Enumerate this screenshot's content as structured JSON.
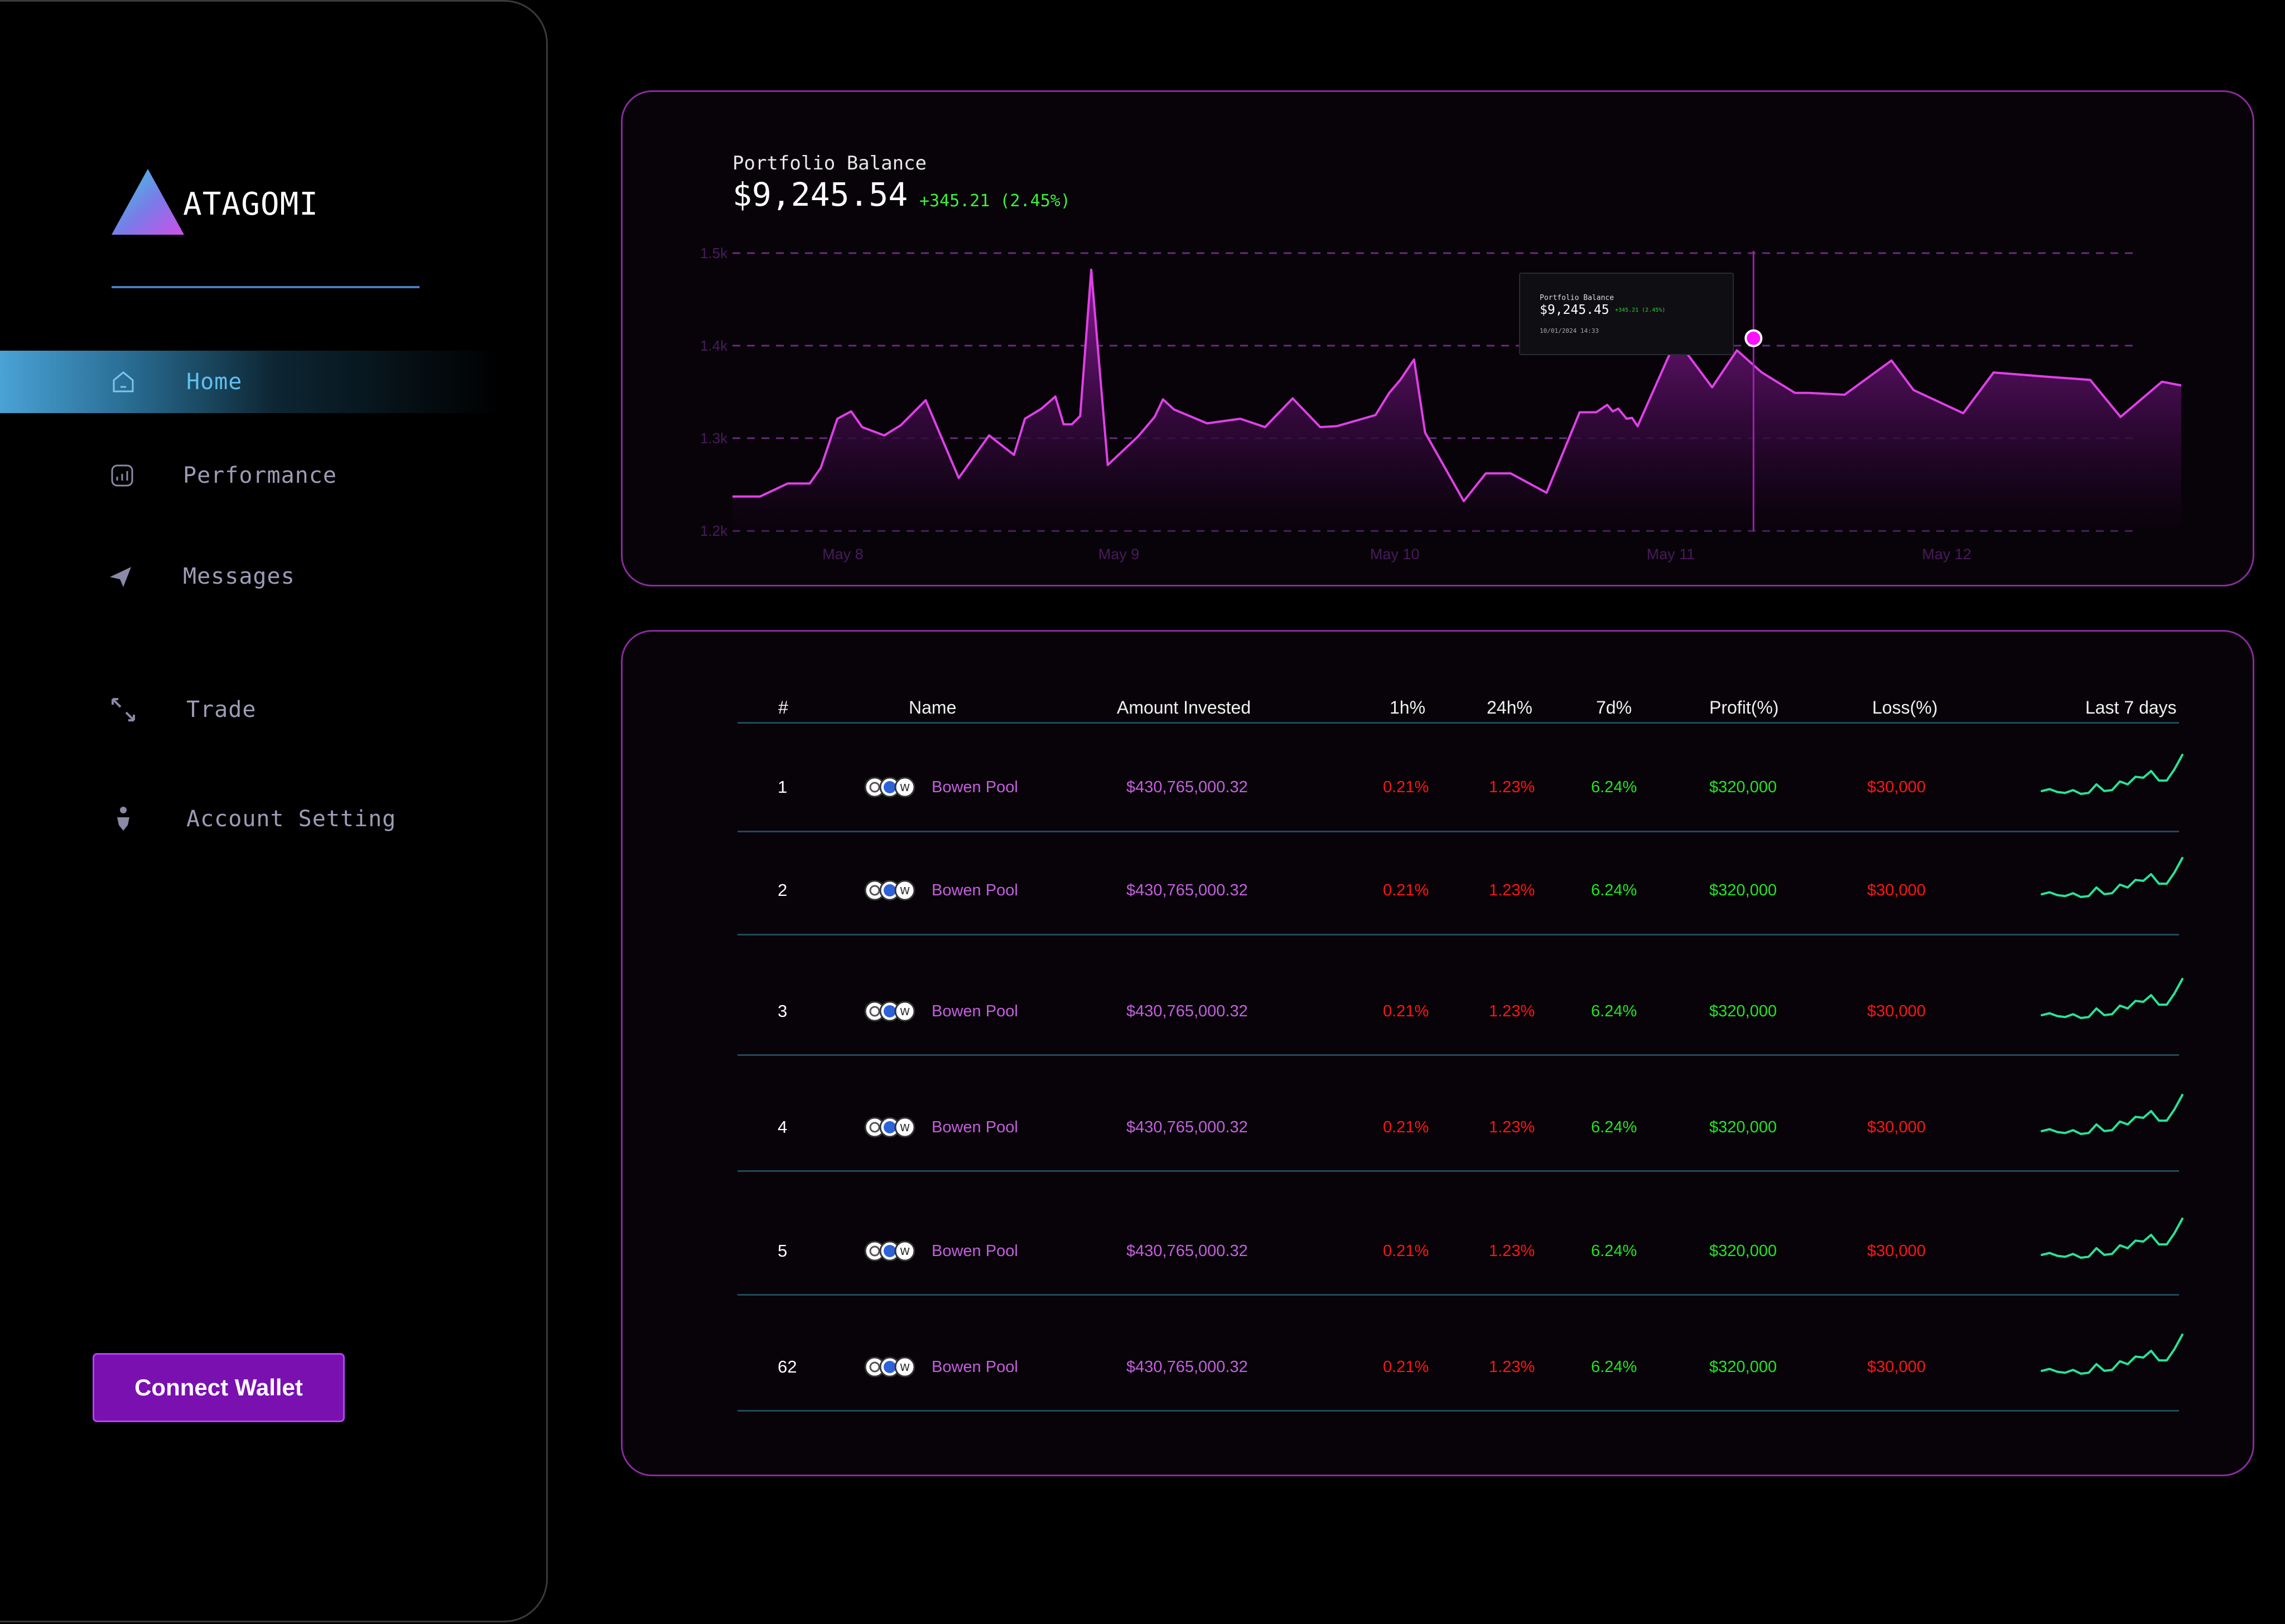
{
  "app": {
    "brand": "ATAGOMI"
  },
  "sidebar": {
    "items": [
      {
        "label": "Home",
        "icon": "home-icon",
        "active": true
      },
      {
        "label": "Performance",
        "icon": "chart-icon"
      },
      {
        "label": "Messages",
        "icon": "send-icon"
      },
      {
        "label": "Trade",
        "icon": "arrows-icon"
      },
      {
        "label": "Account Setting",
        "icon": "user-icon"
      }
    ],
    "connect_wallet": "Connect Wallet"
  },
  "portfolio": {
    "title": "Portfolio Balance",
    "value": "$9,245.54",
    "change": "+345.21 (2.45%)",
    "tooltip": {
      "title": "Portfolio Balance",
      "value": "$9,245.45",
      "change": "+345.21 (2.45%)",
      "date": "10/01/2024 14:33"
    }
  },
  "chart_data": {
    "type": "area",
    "yticks": [
      "1.5k",
      "1.4k",
      "1.3k",
      "1.2k"
    ],
    "xticks": [
      "May 8",
      "May 9",
      "May 10",
      "May 11",
      "May 12"
    ],
    "ylim": [
      1.2,
      1.5
    ],
    "x_domain": [
      7.6,
      12.85
    ],
    "series": [
      {
        "x": [
          7.6,
          7.7,
          7.8,
          7.88,
          7.92,
          7.98,
          8.03,
          8.07,
          8.15,
          8.21,
          8.3,
          8.42,
          8.53,
          8.62,
          8.66,
          8.72,
          8.77,
          8.8,
          8.83,
          8.86,
          8.9,
          8.96,
          9.07,
          9.13,
          9.16,
          9.2,
          9.32,
          9.44,
          9.53,
          9.63,
          9.73,
          9.79,
          9.86,
          9.93,
          9.98,
          10.02,
          10.07,
          10.11,
          10.25,
          10.33,
          10.42,
          10.55,
          10.67,
          10.73,
          10.77,
          10.79,
          10.81,
          10.84,
          10.86,
          10.88,
          11.02,
          11.15,
          11.24,
          11.33,
          11.45,
          11.5,
          11.63,
          11.8,
          11.88,
          12.06,
          12.17,
          12.38,
          12.52,
          12.63,
          12.78,
          12.85
        ],
        "y": [
          1.237,
          1.237,
          1.251,
          1.251,
          1.268,
          1.321,
          1.329,
          1.312,
          1.303,
          1.314,
          1.341,
          1.257,
          1.303,
          1.282,
          1.321,
          1.332,
          1.345,
          1.315,
          1.315,
          1.324,
          1.482,
          1.271,
          1.302,
          1.323,
          1.342,
          1.331,
          1.316,
          1.321,
          1.312,
          1.343,
          1.312,
          1.313,
          1.319,
          1.325,
          1.349,
          1.363,
          1.385,
          1.306,
          1.232,
          1.262,
          1.262,
          1.241,
          1.328,
          1.328,
          1.336,
          1.329,
          1.332,
          1.321,
          1.322,
          1.313,
          1.407,
          1.355,
          1.395,
          1.371,
          1.349,
          1.349,
          1.347,
          1.384,
          1.352,
          1.327,
          1.371,
          1.366,
          1.363,
          1.323,
          1.361,
          1.357
        ]
      }
    ],
    "highlight": {
      "x": 11.3,
      "y": 1.408
    }
  },
  "table": {
    "headers": [
      "#",
      "Name",
      "Amount Invested",
      "1h%",
      "24h%",
      "7d%",
      "Profit(%)",
      "Loss(%)",
      "Last 7 days"
    ],
    "rows": [
      {
        "n": "1",
        "name": "Bowen Pool",
        "amount": "$430,765,000.32",
        "h1": "0.21%",
        "h24": "1.23%",
        "d7": "6.24%",
        "profit": "$320,000",
        "loss": "$30,000"
      },
      {
        "n": "2",
        "name": "Bowen Pool",
        "amount": "$430,765,000.32",
        "h1": "0.21%",
        "h24": "1.23%",
        "d7": "6.24%",
        "profit": "$320,000",
        "loss": "$30,000"
      },
      {
        "n": "3",
        "name": "Bowen Pool",
        "amount": "$430,765,000.32",
        "h1": "0.21%",
        "h24": "1.23%",
        "d7": "6.24%",
        "profit": "$320,000",
        "loss": "$30,000"
      },
      {
        "n": "4",
        "name": "Bowen Pool",
        "amount": "$430,765,000.32",
        "h1": "0.21%",
        "h24": "1.23%",
        "d7": "6.24%",
        "profit": "$320,000",
        "loss": "$30,000"
      },
      {
        "n": "5",
        "name": "Bowen Pool",
        "amount": "$430,765,000.32",
        "h1": "0.21%",
        "h24": "1.23%",
        "d7": "6.24%",
        "profit": "$320,000",
        "loss": "$30,000"
      },
      {
        "n": "62",
        "name": "Bowen Pool",
        "amount": "$430,765,000.32",
        "h1": "0.21%",
        "h24": "1.23%",
        "d7": "6.24%",
        "profit": "$320,000",
        "loss": "$30,000"
      }
    ],
    "sparkline": [
      5,
      7,
      4,
      3,
      6,
      2,
      3,
      12,
      5,
      6,
      15,
      12,
      20,
      19,
      26,
      16,
      16,
      28,
      43
    ],
    "colors": {
      "red": "#ff1414",
      "green": "#20e620",
      "purple": "#c55fe0",
      "spark": "#27e39a"
    }
  }
}
